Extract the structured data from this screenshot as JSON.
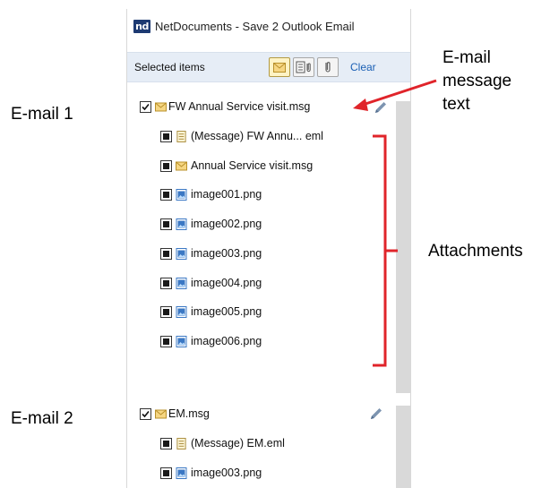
{
  "window": {
    "logo": "nd",
    "title": "NetDocuments - Save 2 Outlook Email"
  },
  "toolbar": {
    "label": "Selected items",
    "buttons": [
      {
        "name": "email-view-button",
        "icon": "envelope-icon",
        "active": true
      },
      {
        "name": "message-attachment-view-button",
        "icon": "document-paperclip-icon",
        "active": false
      },
      {
        "name": "attachment-view-button",
        "icon": "paperclip-icon",
        "active": false
      }
    ],
    "clear_label": "Clear"
  },
  "annotations": {
    "email1": "E-mail 1",
    "email2": "E-mail 2",
    "attachments": "Attachments",
    "message_text": [
      "E-mail",
      "message",
      "text"
    ]
  },
  "emails": [
    {
      "label": "FW Annual Service visit.msg",
      "checked": true,
      "children": [
        {
          "label": "(Message) FW Annu... eml",
          "icon": "document-icon"
        },
        {
          "label": "Annual Service visit.msg",
          "icon": "envelope-icon"
        },
        {
          "label": "image001.png",
          "icon": "image-icon"
        },
        {
          "label": "image002.png",
          "icon": "image-icon"
        },
        {
          "label": "image003.png",
          "icon": "image-icon"
        },
        {
          "label": "image004.png",
          "icon": "image-icon"
        },
        {
          "label": "image005.png",
          "icon": "image-icon"
        },
        {
          "label": "image006.png",
          "icon": "image-icon"
        }
      ]
    },
    {
      "label": "EM.msg",
      "checked": true,
      "children": [
        {
          "label": "(Message) EM.eml",
          "icon": "document-icon"
        },
        {
          "label": "image003.png",
          "icon": "image-icon"
        }
      ]
    }
  ],
  "colors": {
    "annotation_red": "#e0242a",
    "accent_blue": "#1a5fb4",
    "toolbar_bg": "#e6edf6"
  }
}
